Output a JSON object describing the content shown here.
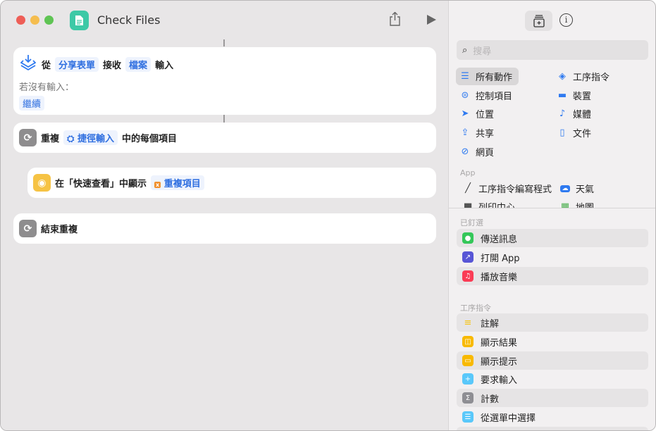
{
  "window": {
    "title": "Check Files"
  },
  "colors": {
    "accent": "#2f7af0",
    "app_icon": "#3dc9a6"
  },
  "actions": [
    {
      "parts": [
        "從",
        "分享表單",
        "接收",
        "檔案",
        "輸入"
      ],
      "sub_label": "若沒有輸入：",
      "sub_value": "繼續"
    },
    {
      "verb": "重複",
      "token": "捷徑輸入",
      "suffix": "中的每個項目"
    },
    {
      "verb": "在「快速查看」中顯示",
      "token": "重複項目"
    },
    {
      "verb": "結束重複"
    }
  ],
  "sidebar": {
    "search_placeholder": "搜尋",
    "categories": [
      {
        "label": "所有動作",
        "icon": "list-icon",
        "selected": true
      },
      {
        "label": "工序指令",
        "icon": "shortcuts-icon"
      },
      {
        "label": "控制項目",
        "icon": "toggle-icon"
      },
      {
        "label": "裝置",
        "icon": "display-icon"
      },
      {
        "label": "位置",
        "icon": "location-icon"
      },
      {
        "label": "媒體",
        "icon": "music-note-icon"
      },
      {
        "label": "共享",
        "icon": "share-icon"
      },
      {
        "label": "文件",
        "icon": "document-icon"
      },
      {
        "label": "網頁",
        "icon": "compass-icon"
      }
    ],
    "app_label": "App",
    "apps": [
      {
        "label": "工序指令編寫程式"
      },
      {
        "label": "天氣"
      },
      {
        "label": "列印中心"
      },
      {
        "label": "地圖"
      }
    ],
    "pinned_label": "已釘選",
    "pinned": [
      {
        "label": "傳送訊息",
        "color": "#34c759",
        "icon": "message-icon"
      },
      {
        "label": "打開 App",
        "color": "#5856d6",
        "icon": "arrow-icon"
      },
      {
        "label": "播放音樂",
        "color": "#fa3c55",
        "icon": "music-icon"
      }
    ],
    "scripting_label": "工序指令",
    "scripting": [
      {
        "label": "註解",
        "color": "#f5c518",
        "icon": "comment-icon"
      },
      {
        "label": "顯示結果",
        "color": "#f8b900",
        "icon": "result-icon"
      },
      {
        "label": "顯示提示",
        "color": "#f8b900",
        "icon": "alert-icon"
      },
      {
        "label": "要求輸入",
        "color": "#5ac8fa",
        "icon": "ask-icon"
      },
      {
        "label": "計數",
        "color": "#8e8e93",
        "icon": "sigma-icon"
      },
      {
        "label": "從選單中選擇",
        "color": "#5ac8fa",
        "icon": "menu-icon"
      }
    ]
  }
}
